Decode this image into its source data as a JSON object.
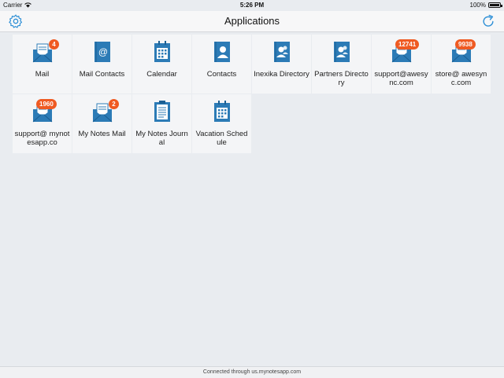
{
  "status_bar": {
    "carrier": "Carrier",
    "time": "5:26 PM",
    "battery": "100%",
    "battery_level": 1.0
  },
  "nav": {
    "title": "Applications",
    "left_icon": "gear-icon",
    "right_icon": "refresh-icon"
  },
  "colors": {
    "accent": "#2d8fd6",
    "badge": "#ef5a22",
    "icon": "#2c7bb6"
  },
  "apps": [
    {
      "label": "Mail",
      "icon": "mail-icon",
      "badge": "4"
    },
    {
      "label": "Mail Contacts",
      "icon": "mail-contacts-icon"
    },
    {
      "label": "Calendar",
      "icon": "calendar-icon"
    },
    {
      "label": "Contacts",
      "icon": "contacts-icon"
    },
    {
      "label": "Inexika Directory",
      "icon": "directory-icon"
    },
    {
      "label": "Partners Directory",
      "icon": "directory-icon"
    },
    {
      "label": "support@awesync.com",
      "icon": "mail-icon",
      "badge": "12741"
    },
    {
      "label": "store@ awesync.com",
      "icon": "mail-icon",
      "badge": "9938"
    },
    {
      "label": "support@ mynotesapp.co",
      "icon": "mail-icon",
      "badge": "1960"
    },
    {
      "label": "My Notes Mail",
      "icon": "mail-icon",
      "badge": "2"
    },
    {
      "label": "My Notes Journal",
      "icon": "journal-icon"
    },
    {
      "label": "Vacation Schedule",
      "icon": "calendar-icon"
    }
  ],
  "footer": {
    "text": "Connected through us.mynotesapp.com"
  }
}
